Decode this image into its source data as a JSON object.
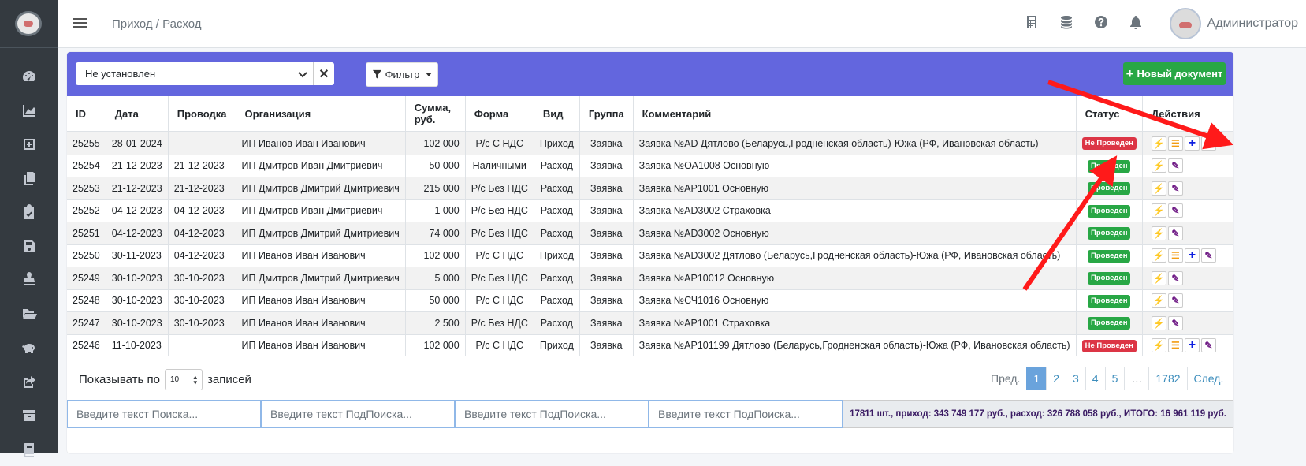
{
  "header": {
    "breadcrumb": "Приход / Расход",
    "user_name": "Администратор"
  },
  "toolbar": {
    "org_select_value": "Не установлен",
    "filter_label": "Фильтр",
    "new_doc_label": "Новый документ"
  },
  "columns": [
    "ID",
    "Дата",
    "Проводка",
    "Организация",
    "Сумма, руб.",
    "Форма",
    "Вид",
    "Группа",
    "Комментарий",
    "Статус",
    "Действия"
  ],
  "rows": [
    {
      "id": "25255",
      "date": "28-01-2024",
      "posting": "",
      "org": "ИП Иванов Иван Иванович",
      "sum": "102 000",
      "form": "Р/с С НДС",
      "kind": "Приход",
      "group": "Заявка",
      "comment": "Заявка №AD Дятлово (Беларусь,Гродненская область)-Южа (РФ, Ивановская область)",
      "status": "Не Проведен",
      "status_type": "red",
      "actions": [
        "bolt",
        "list",
        "plus",
        "edit"
      ]
    },
    {
      "id": "25254",
      "date": "21-12-2023",
      "posting": "21-12-2023",
      "org": "ИП Дмитров Иван Дмитриевич",
      "sum": "50 000",
      "form": "Наличными",
      "kind": "Расход",
      "group": "Заявка",
      "comment": "Заявка №ОА1008 Основную",
      "status": "Проведен",
      "status_type": "green",
      "actions": [
        "bolt",
        "edit"
      ]
    },
    {
      "id": "25253",
      "date": "21-12-2023",
      "posting": "21-12-2023",
      "org": "ИП Дмитров Дмитрий Дмитриевич",
      "sum": "215 000",
      "form": "Р/с Без НДС",
      "kind": "Расход",
      "group": "Заявка",
      "comment": "Заявка №АР1001 Основную",
      "status": "Проведен",
      "status_type": "green",
      "actions": [
        "bolt",
        "edit"
      ]
    },
    {
      "id": "25252",
      "date": "04-12-2023",
      "posting": "04-12-2023",
      "org": "ИП Дмитров Иван Дмитриевич",
      "sum": "1 000",
      "form": "Р/с Без НДС",
      "kind": "Расход",
      "group": "Заявка",
      "comment": "Заявка №AD3002 Страховка",
      "status": "Проведен",
      "status_type": "green",
      "actions": [
        "bolt",
        "edit"
      ]
    },
    {
      "id": "25251",
      "date": "04-12-2023",
      "posting": "04-12-2023",
      "org": "ИП Дмитров Дмитрий Дмитриевич",
      "sum": "74 000",
      "form": "Р/с Без НДС",
      "kind": "Расход",
      "group": "Заявка",
      "comment": "Заявка №AD3002 Основную",
      "status": "Проведен",
      "status_type": "green",
      "actions": [
        "bolt",
        "edit"
      ]
    },
    {
      "id": "25250",
      "date": "30-11-2023",
      "posting": "04-12-2023",
      "org": "ИП Иванов Иван Иванович",
      "sum": "102 000",
      "form": "Р/с С НДС",
      "kind": "Приход",
      "group": "Заявка",
      "comment": "Заявка №AD3002 Дятлово (Беларусь,Гродненская область)-Южа (РФ, Ивановская область)",
      "status": "Проведен",
      "status_type": "green",
      "actions": [
        "bolt",
        "list",
        "plus",
        "edit"
      ]
    },
    {
      "id": "25249",
      "date": "30-10-2023",
      "posting": "30-10-2023",
      "org": "ИП Дмитров Дмитрий Дмитриевич",
      "sum": "5 000",
      "form": "Р/с Без НДС",
      "kind": "Расход",
      "group": "Заявка",
      "comment": "Заявка №АР10012 Основную",
      "status": "Проведен",
      "status_type": "green",
      "actions": [
        "bolt",
        "edit"
      ]
    },
    {
      "id": "25248",
      "date": "30-10-2023",
      "posting": "30-10-2023",
      "org": "ИП Иванов Иван Иванович",
      "sum": "50 000",
      "form": "Р/с С НДС",
      "kind": "Расход",
      "group": "Заявка",
      "comment": "Заявка №СЧ1016 Основную",
      "status": "Проведен",
      "status_type": "green",
      "actions": [
        "bolt",
        "edit"
      ]
    },
    {
      "id": "25247",
      "date": "30-10-2023",
      "posting": "30-10-2023",
      "org": "ИП Иванов Иван Иванович",
      "sum": "2 500",
      "form": "Р/с Без НДС",
      "kind": "Расход",
      "group": "Заявка",
      "comment": "Заявка №АР1001 Страховка",
      "status": "Проведен",
      "status_type": "green",
      "actions": [
        "bolt",
        "edit"
      ]
    },
    {
      "id": "25246",
      "date": "11-10-2023",
      "posting": "",
      "org": "ИП Иванов Иван Иванович",
      "sum": "102 000",
      "form": "Р/с С НДС",
      "kind": "Приход",
      "group": "Заявка",
      "comment": "Заявка №АР101199 Дятлово (Беларусь,Гродненская область)-Южа (РФ, Ивановская область)",
      "status": "Не Проведен",
      "status_type": "red",
      "actions": [
        "bolt",
        "list",
        "plus",
        "edit"
      ]
    }
  ],
  "footer": {
    "show_label": "Показывать по",
    "per_page": "10",
    "records_label": "записей",
    "pagination": [
      "Пред.",
      "1",
      "2",
      "3",
      "4",
      "5",
      "…",
      "1782",
      "След."
    ],
    "active_page": "1",
    "search_placeholder": "Введите текст Поиска...",
    "subsearch_placeholder": "Введите текст ПодПоиска...",
    "summary": "17811 шт., приход: 343 749 177 руб., расход: 326 788 058 руб., ИТОГО: 16 961 119 руб."
  },
  "icons": {
    "sidebar": [
      "dashboard-icon",
      "chart-area-icon",
      "plus-square-icon",
      "copy-icon",
      "clipboard-check-icon",
      "save-icon",
      "stamp-icon",
      "folder-open-icon",
      "piggy-bank-icon",
      "share-square-icon",
      "archive-icon",
      "book-icon"
    ],
    "topbar": [
      "calculator-icon",
      "coins-icon",
      "question-circle-icon",
      "bell-icon"
    ]
  },
  "colors": {
    "header_band": "#6366de",
    "success": "#28a745",
    "danger": "#dc3545",
    "annotation_arrow": "#ff1a1a"
  }
}
